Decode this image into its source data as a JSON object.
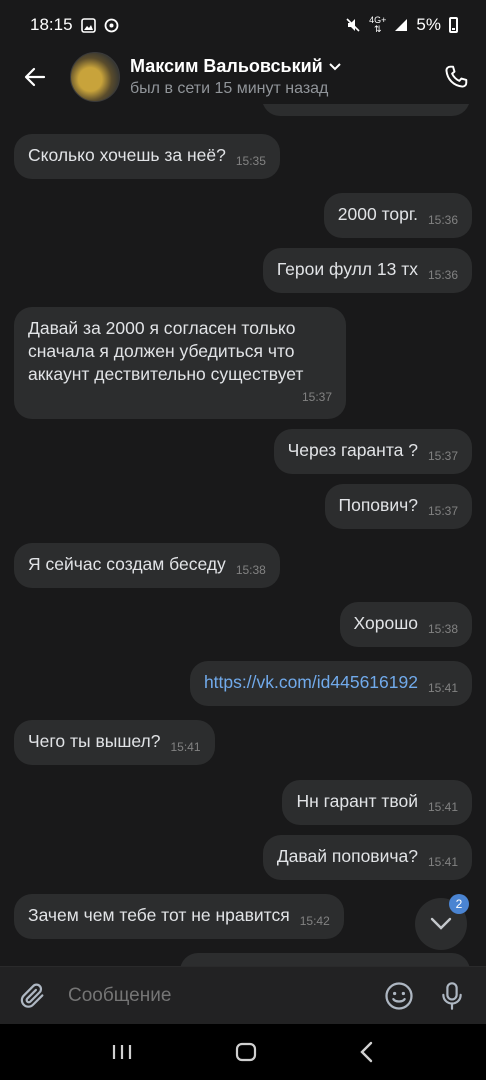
{
  "status_bar": {
    "time": "18:15",
    "network": "4G+",
    "battery": "5%"
  },
  "header": {
    "name": "Максим Вальовський",
    "status": "был в сети 15 минут назад"
  },
  "messages": [
    {
      "side": "in",
      "text": "Сколько хочешь за неё?",
      "time": "15:35"
    },
    {
      "side": "out",
      "text": "2000 торг.",
      "time": "15:36"
    },
    {
      "side": "out",
      "text": "Герои фулл 13 тх",
      "time": "15:36"
    },
    {
      "side": "in",
      "text": "Давай за 2000 я согласен только сначала я должен убедиться что аккаунт дествительно существует",
      "time": "15:37"
    },
    {
      "side": "out",
      "text": "Через гаранта ?",
      "time": "15:37"
    },
    {
      "side": "out",
      "text": "Попович?",
      "time": "15:37"
    },
    {
      "side": "in",
      "text": "Я сейчас создам беседу",
      "time": "15:38"
    },
    {
      "side": "out",
      "text": "Хорошо",
      "time": "15:38"
    },
    {
      "side": "out",
      "text": "https://vk.com/id445616192",
      "time": "15:41",
      "link": true
    },
    {
      "side": "in",
      "text": "Чего ты вышел?",
      "time": "15:41"
    },
    {
      "side": "out",
      "text": "Нн гарант твой",
      "time": "15:41"
    },
    {
      "side": "out",
      "text": "Давай поповича?",
      "time": "15:41"
    },
    {
      "side": "in",
      "text": "Зачем чем тебе тот не нравится",
      "time": "15:42"
    }
  ],
  "scroll_badge": "2",
  "composer": {
    "placeholder": "Сообщение"
  },
  "icons": {
    "back": "arrow-left-icon",
    "call": "phone-icon",
    "attach": "paperclip-icon",
    "emoji": "smiley-icon",
    "mic": "microphone-icon",
    "scroll": "chevron-down-icon"
  },
  "colors": {
    "background": "#19191a",
    "bubble": "#2c2d2e",
    "link": "#71aaeb",
    "badge": "#4a84d2"
  }
}
